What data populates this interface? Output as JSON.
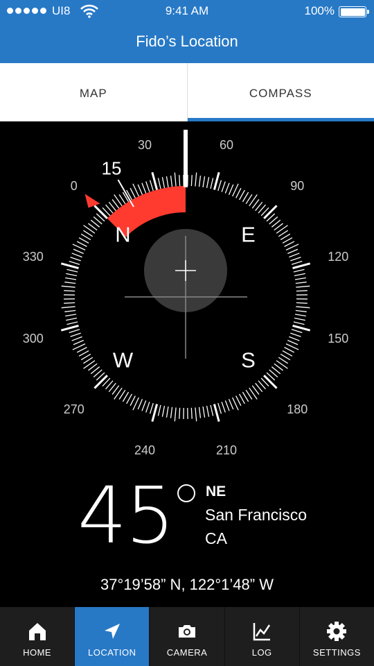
{
  "status_bar": {
    "carrier": "UI8",
    "time": "9:41 AM",
    "battery": "100%"
  },
  "header": {
    "title": "Fido’s Location"
  },
  "tabs": [
    {
      "label": "MAP",
      "active": false
    },
    {
      "label": "COMPASS",
      "active": true
    }
  ],
  "compass": {
    "heading_deg": 45,
    "bearing_marker_deg": 15,
    "bearing_marker_label": "15",
    "ring_labels": [
      "0",
      "30",
      "60",
      "90",
      "120",
      "150",
      "180",
      "210",
      "240",
      "270",
      "300",
      "330"
    ],
    "cardinals": [
      "N",
      "E",
      "S",
      "W"
    ],
    "colors": {
      "accent": "#ff3b30",
      "ring": "#ffffff",
      "center": "#3a3a3a"
    }
  },
  "readout": {
    "degrees": "45",
    "direction": "NE",
    "city": "San Francisco",
    "state": "CA",
    "coordinates": "37°19’58” N, 122°1’48” W"
  },
  "nav": [
    {
      "label": "HOME",
      "icon": "home-icon",
      "active": false
    },
    {
      "label": "LOCATION",
      "icon": "location-arrow-icon",
      "active": true
    },
    {
      "label": "CAMERA",
      "icon": "camera-icon",
      "active": false
    },
    {
      "label": "LOG",
      "icon": "chart-line-icon",
      "active": false
    },
    {
      "label": "SETTINGS",
      "icon": "gear-icon",
      "active": false
    }
  ],
  "colors": {
    "brand": "#2779c6",
    "nav_bg": "#1e1e1e"
  }
}
